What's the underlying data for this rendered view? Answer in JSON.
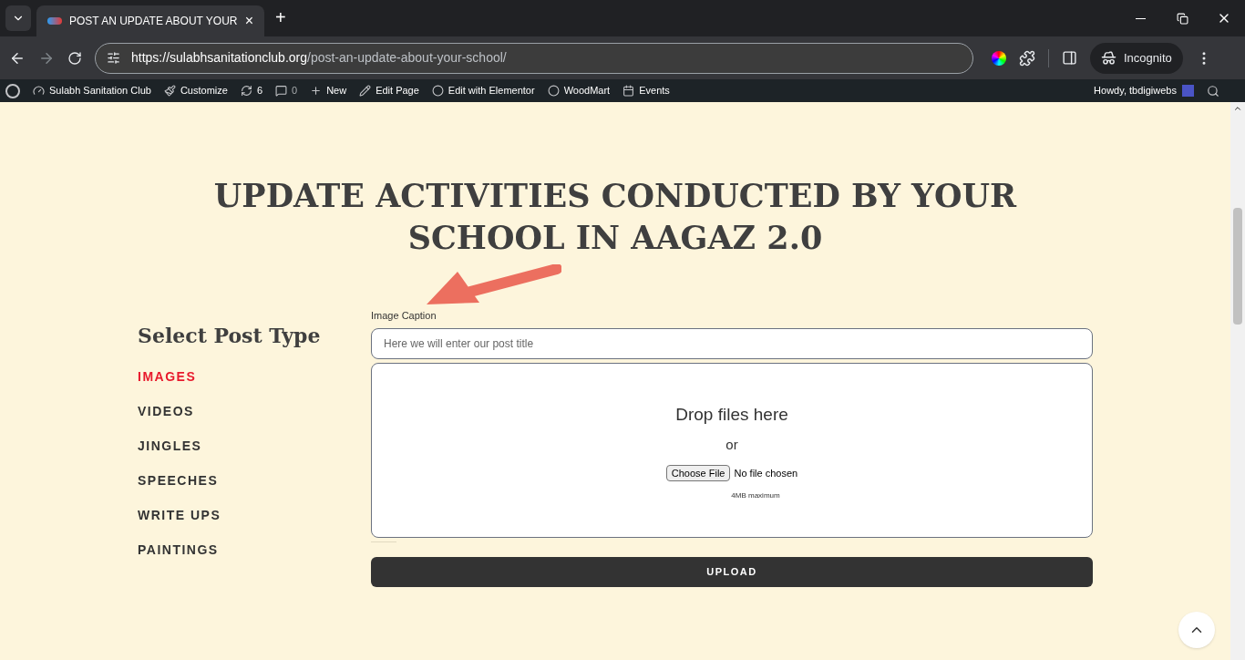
{
  "browser": {
    "tab_title": "POST AN UPDATE ABOUT YOUR",
    "close_tab": "×",
    "new_tab": "+",
    "url_host": "https://sulabhsanitationclub.org",
    "url_path": "/post-an-update-about-your-school/",
    "profile": "Incognito"
  },
  "admin_bar": {
    "items": [
      {
        "kind": "site",
        "label": "Sulabh Sanitation Club"
      },
      {
        "kind": "customize",
        "label": "Customize"
      },
      {
        "kind": "updates",
        "label": "6"
      },
      {
        "kind": "comments",
        "label": "0"
      },
      {
        "kind": "new",
        "label": "New"
      },
      {
        "kind": "edit",
        "label": "Edit Page"
      },
      {
        "kind": "elementor",
        "label": "Edit with Elementor"
      },
      {
        "kind": "woodmart",
        "label": "WoodMart"
      },
      {
        "kind": "events",
        "label": "Events"
      }
    ],
    "greeting": "Howdy, tbdigiwebs"
  },
  "page": {
    "heading": "UPDATE ACTIVITIES CONDUCTED BY YOUR SCHOOL IN AAGAZ 2.0",
    "sidebar_title": "Select Post Type",
    "post_types": [
      {
        "label": "IMAGES",
        "selected": true
      },
      {
        "label": "VIDEOS",
        "selected": false
      },
      {
        "label": "JINGLES",
        "selected": false
      },
      {
        "label": "SPEECHES",
        "selected": false
      },
      {
        "label": "WRITE UPS",
        "selected": false
      },
      {
        "label": "PAINTINGS",
        "selected": false
      }
    ],
    "caption_label": "Image Caption",
    "caption_placeholder": "Here we will enter our post title",
    "dropzone": {
      "title": "Drop files here",
      "or": "or",
      "choose_button": "Choose File",
      "file_status": "No file chosen",
      "limit": "4MB maximum"
    },
    "upload_button": "UPLOAD"
  }
}
